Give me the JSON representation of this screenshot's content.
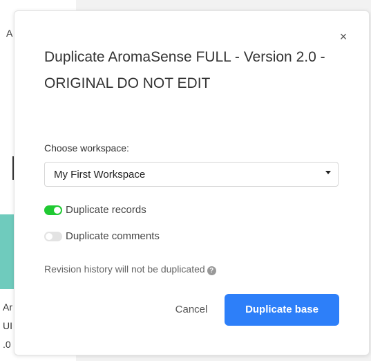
{
  "background": {
    "fragments": [
      "A",
      "Ar",
      "UI",
      ".0"
    ]
  },
  "dialog": {
    "close_symbol": "×",
    "title": "Duplicate AromaSense FULL - Version 2.0 - ORIGINAL DO NOT EDIT",
    "workspace_label": "Choose workspace:",
    "workspace_value": "My First Workspace",
    "toggles": {
      "records": {
        "label": "Duplicate records",
        "on": true
      },
      "comments": {
        "label": "Duplicate comments",
        "on": false
      }
    },
    "note": "Revision history will not be duplicated",
    "help_symbol": "?",
    "cancel_label": "Cancel",
    "primary_label": "Duplicate base"
  },
  "colors": {
    "primary": "#2d7ff9",
    "toggle_on": "#20c933",
    "toggle_off": "#e3e3e3"
  }
}
